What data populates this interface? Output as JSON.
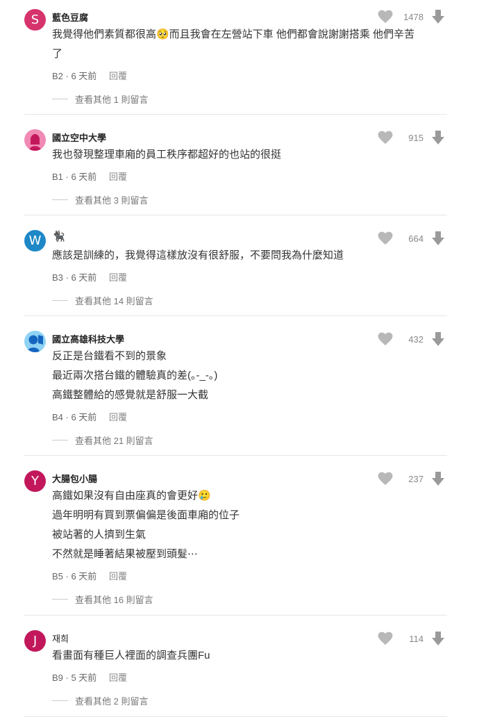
{
  "comments": [
    {
      "avatar_letter": "S",
      "avatar_color": "#d6336c",
      "author": "藍色豆腐",
      "likes": "1478",
      "lines": [
        "我覺得他們素質都很高🥺而且我會在左營站下車 他們都會說謝謝搭乘 他們辛苦",
        "了"
      ],
      "floor": "B2",
      "time": "6 天前",
      "reply_label": "回覆",
      "more_replies": "查看其他 1 則留言"
    },
    {
      "avatar_letter": "",
      "avatar_color": "#f08ab5",
      "author": "國立空中大學",
      "likes": "915",
      "lines": [
        "我也發現整理車廂的員工秩序都超好的也站的很挺"
      ],
      "floor": "B1",
      "time": "6 天前",
      "reply_label": "回覆",
      "more_replies": "查看其他 3 則留言"
    },
    {
      "avatar_letter": "W",
      "avatar_color": "#1e88c7",
      "author": "🐈‍⬛",
      "likes": "664",
      "lines": [
        "應該是訓練的，我覺得這樣放沒有很舒服，不要問我為什麼知道"
      ],
      "floor": "B3",
      "time": "6 天前",
      "reply_label": "回覆",
      "more_replies": "查看其他 14 則留言"
    },
    {
      "avatar_letter": "",
      "avatar_color": "#8fd3f4",
      "author": "國立高雄科技大學",
      "likes": "432",
      "lines": [
        "反正是台鐵看不到的景象",
        "最近兩次搭台鐵的體驗真的差(｡-_-｡)",
        "高鐵整體給的感覺就是舒服一大截"
      ],
      "floor": "B4",
      "time": "6 天前",
      "reply_label": "回覆",
      "more_replies": "查看其他 21 則留言"
    },
    {
      "avatar_letter": "Y",
      "avatar_color": "#c2185b",
      "author": "大腸包小腸",
      "likes": "237",
      "lines": [
        "高鐵如果沒有自由座真的會更好🥲",
        "過年明明有買到票偏偏是後面車廂的位子",
        "被站著的人擠到生氣",
        "不然就是睡著結果被壓到頭髮⋯"
      ],
      "floor": "B5",
      "time": "6 天前",
      "reply_label": "回覆",
      "more_replies": "查看其他 16 則留言"
    },
    {
      "avatar_letter": "J",
      "avatar_color": "#c2185b",
      "author": "재희",
      "likes": "114",
      "lines": [
        "看畫面有種巨人裡面的調查兵團Fu"
      ],
      "floor": "B9",
      "time": "5 天前",
      "reply_label": "回覆",
      "more_replies": "查看其他 2 則留言"
    }
  ]
}
